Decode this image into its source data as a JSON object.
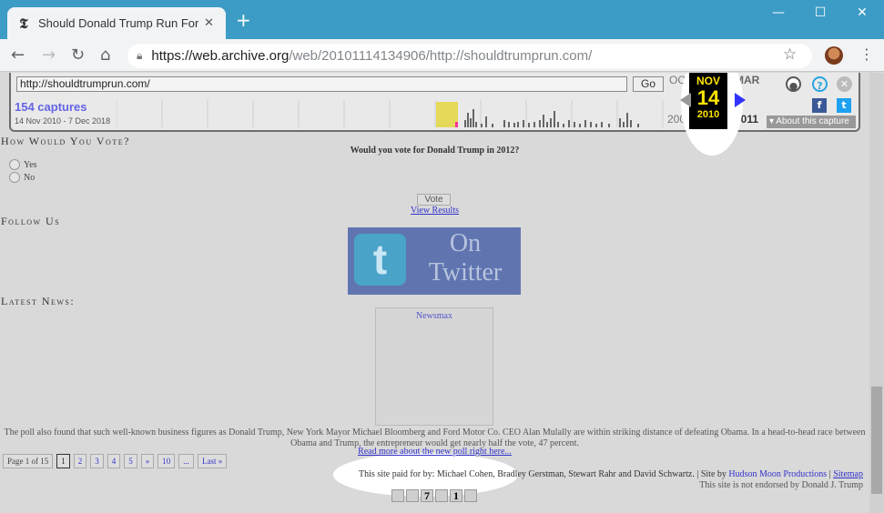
{
  "browser": {
    "tab_title": "Should Donald Trump Run For Pr",
    "tab_close": "✕",
    "new_tab": "+",
    "url_host": "https://web.archive.org",
    "url_path": "/web/20101114134906/http://shouldtrumprun.com/",
    "win_min": "—",
    "win_max": "☐",
    "win_close": "✕"
  },
  "wayback": {
    "url_value": "http://shouldtrumprun.com/",
    "go_label": "Go",
    "captures": "154 captures",
    "range": "14 Nov 2010 - 7 Dec 2018",
    "prev_month": "OCT",
    "cur_month": "NOV",
    "next_month": "MAR",
    "cur_day": "14",
    "prev_year": "2009",
    "cur_year": "2010",
    "next_year": "2011",
    "about": "About this capture",
    "accent": "#ffe500"
  },
  "site": {
    "vote_heading": "How Would You Vote?",
    "question": "Would you vote for Donald Trump in 2012?",
    "option_yes": "Yes",
    "option_no": "No",
    "vote_button": "Vote",
    "view_results": "View Results",
    "follow_heading": "Follow Us",
    "twitter_line1": "On",
    "twitter_line2": "Twitter",
    "news_heading": "Latest News:",
    "newsmax_alt": "Newsmax",
    "news_text": "The poll also found that such well-known business figures as Donald Trump, New York Mayor Michael Bloomberg and Ford Motor Co. CEO Alan Mulally are within striking distance of defeating Obama. In a head-to-head race between Obama and Trump, the entrepreneur would get nearly half the vote, 47 percent.",
    "read_more": "Read more about the new poll right here...",
    "pager": {
      "info": "Page 1 of 15",
      "pages": [
        "1",
        "2",
        "3",
        "4",
        "5",
        "»",
        "10",
        "...",
        "Last »"
      ]
    },
    "paid_for": "This site paid for by: Michael Cohen, Bradley Gerstman, Stewart Rahr and David Schwartz.",
    "site_by_prefix": "| Site by",
    "site_by_link": "Hudson Moon Productions",
    "sitemap": "Sitemap",
    "not_endorsed": "This site is not endorsed by Donald J. Trump",
    "counter_digits": [
      "",
      "",
      "7",
      "",
      "1",
      ""
    ]
  }
}
